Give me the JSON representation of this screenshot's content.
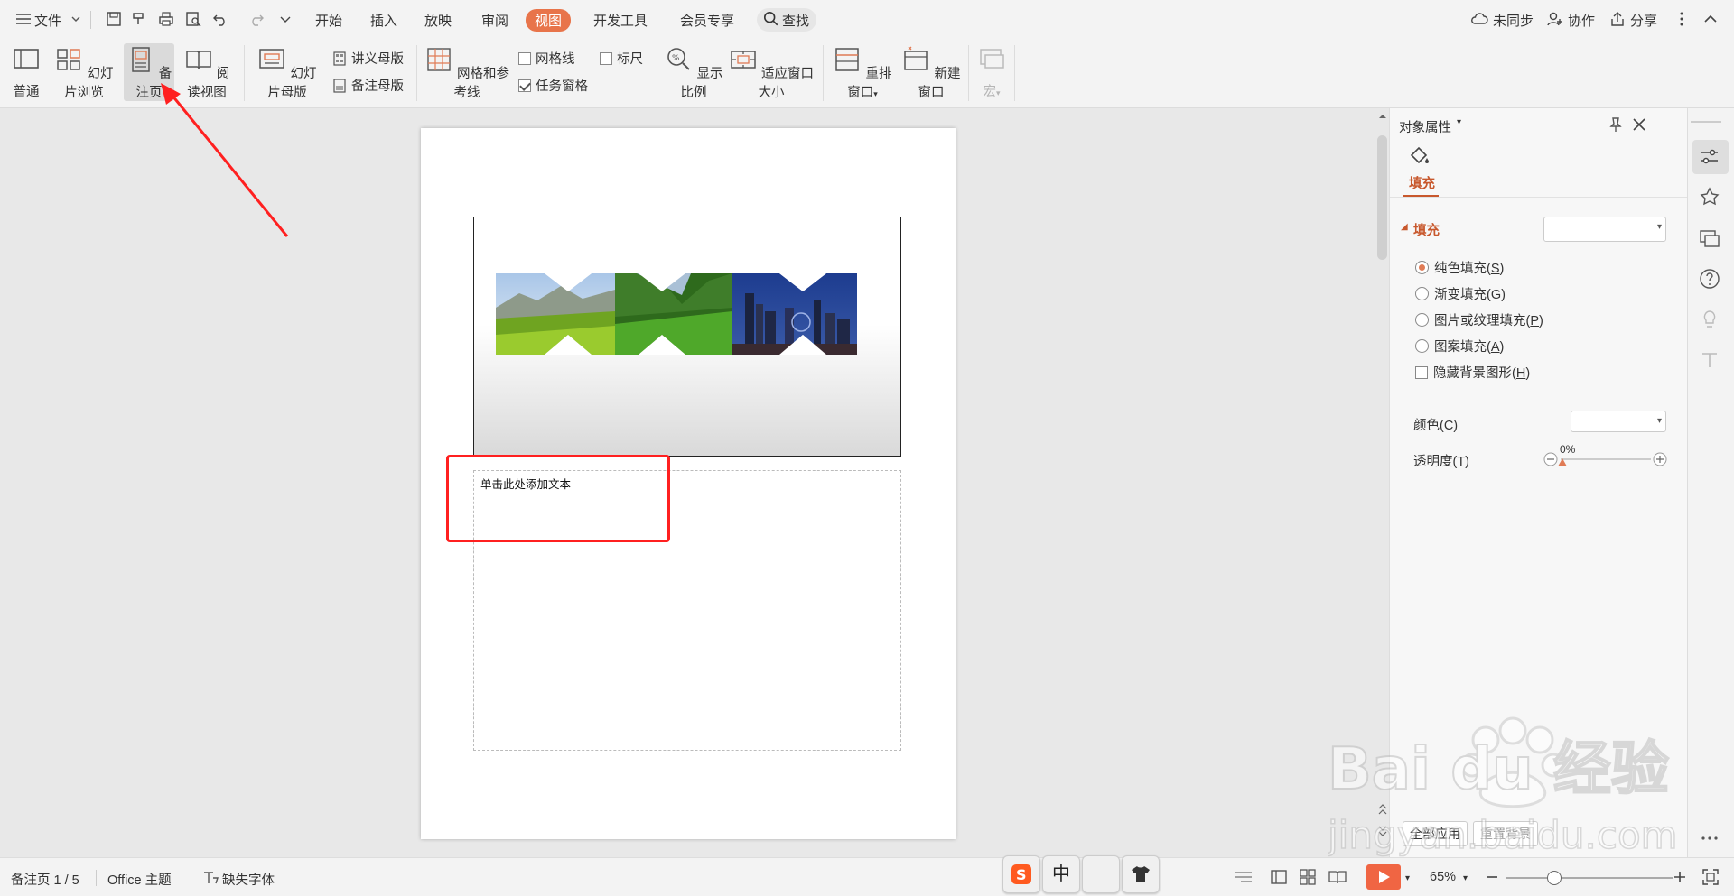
{
  "menubar": {
    "file_label": "文件",
    "tabs": [
      {
        "label": "开始"
      },
      {
        "label": "插入"
      },
      {
        "label": "放映"
      },
      {
        "label": "审阅"
      },
      {
        "label": "视图"
      },
      {
        "label": "开发工具"
      },
      {
        "label": "会员专享"
      }
    ],
    "search_label": "查找",
    "sync_label": "未同步",
    "collab_label": "协作",
    "share_label": "分享"
  },
  "ribbon": {
    "normal": "普通",
    "slide_browse": "幻灯片浏览",
    "notes_page": "备注页",
    "reading_view": "阅读视图",
    "slide_master": "幻灯片母版",
    "handout_master": "讲义母版",
    "notes_master": "备注母版",
    "grid_guides": "网格和参考线",
    "gridlines": "网格线",
    "task_pane": "任务窗格",
    "ruler": "标尺",
    "zoom": "显示比例",
    "fit_window": "适应窗口大小",
    "arrange": "重排窗口",
    "new_window": "新建窗口",
    "macro": "宏",
    "gridlines_checked": false,
    "task_pane_checked": true,
    "ruler_checked": false
  },
  "canvas": {
    "notes_placeholder": "单击此处添加文本"
  },
  "panel": {
    "title": "对象属性",
    "tab_fill": "填充",
    "section_fill": "填充",
    "options": [
      {
        "label": "纯色填充",
        "key": "S",
        "selected": true
      },
      {
        "label": "渐变填充",
        "key": "G",
        "selected": false
      },
      {
        "label": "图片或纹理填充",
        "key": "P",
        "selected": false
      },
      {
        "label": "图案填充",
        "key": "A",
        "selected": false
      }
    ],
    "hide_bg_label": "隐藏背景图形",
    "hide_bg_key": "H",
    "color_label": "颜色(C)",
    "transparency_label": "透明度(T)",
    "transparency_value": "0%",
    "apply_all": "全部应用",
    "reset": "重置背景"
  },
  "status": {
    "page": "备注页 1 / 5",
    "theme": "Office 主题",
    "missing_font": "缺失字体",
    "zoom": "65%"
  },
  "ime": {
    "zh": "中"
  },
  "watermark": {
    "brand": "Bai du 经验",
    "url": "jingyan.baidu.com"
  },
  "colors": {
    "accent": "#e8744a",
    "highlight_red": "#ff2020",
    "panel_accent": "#c8582d"
  }
}
